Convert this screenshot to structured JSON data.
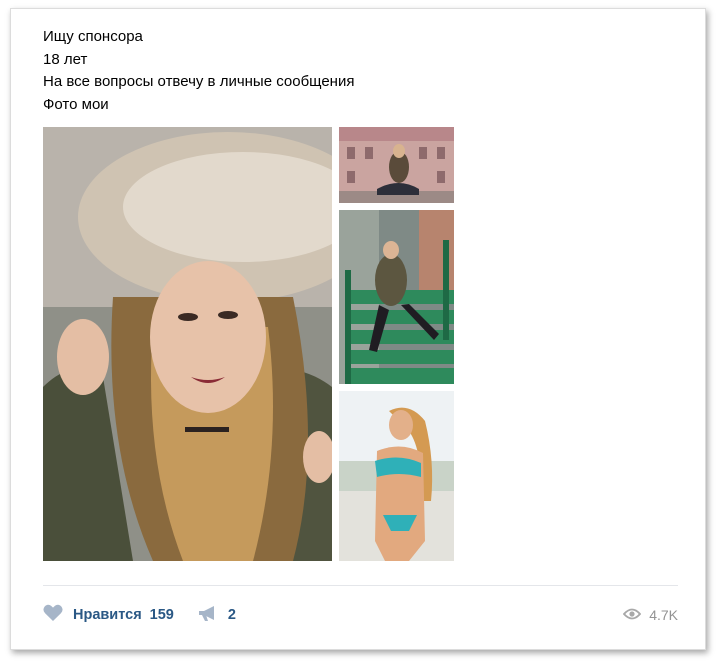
{
  "post": {
    "lines": [
      "Ищу спонсора",
      "18 лет",
      "На все вопросы отвечу в личные сообщения",
      "Фото мои"
    ]
  },
  "photos": [
    {
      "name": "photo-main-portrait"
    },
    {
      "name": "photo-building-sitting"
    },
    {
      "name": "photo-green-stairs"
    },
    {
      "name": "photo-beach-swimsuit"
    }
  ],
  "actions": {
    "like_label": "Нравится",
    "like_count": "159",
    "like_icon": "heart-icon",
    "share_count": "2",
    "share_icon": "megaphone-icon",
    "views_count": "4.7K",
    "views_icon": "eye-icon"
  },
  "colors": {
    "link": "#2a5885",
    "icon": "#a6b5c8",
    "muted": "#939393"
  }
}
